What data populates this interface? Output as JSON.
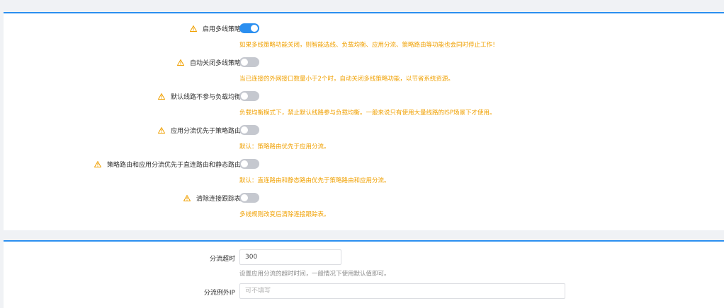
{
  "policies": [
    {
      "label": "启用多线策略",
      "enabled": true,
      "hint": "如果多线策略功能关闭，则智能选线、负载均衡、应用分流、策略路由等功能也会同时停止工作！"
    },
    {
      "label": "自动关闭多线策略",
      "enabled": false,
      "hint": "当已连接的外网接口数量小于2个时，自动关闭多线策略功能，以节省系统资源。"
    },
    {
      "label": "默认线路不参与负载均衡",
      "enabled": false,
      "hint": "负载均衡模式下，禁止默认线路参与负载均衡。一般来说只有使用大量线路的ISP场景下才使用。"
    },
    {
      "label": "应用分流优先于策略路由",
      "enabled": false,
      "hint": "默认：策略路由优先于应用分流。"
    },
    {
      "label": "策略路由和应用分流优先于直连路由和静态路由",
      "enabled": false,
      "hint": "默认：直连路由和静态路由优先于策略路由和应用分流。"
    },
    {
      "label": "清除连接跟踪表",
      "enabled": false,
      "hint": "多线规则改变后清除连接跟踪表。"
    }
  ],
  "timeout": {
    "label": "分流超时",
    "value": "300",
    "hint": "设置应用分流的超时时间，一般情况下使用默认值即可。"
  },
  "exception_ip": {
    "label": "分流例外IP",
    "placeholder": "可不填写"
  },
  "colors": {
    "accent": "#2b8ff0",
    "warning": "#f0a000",
    "switch_off": "#c5c8cf"
  }
}
